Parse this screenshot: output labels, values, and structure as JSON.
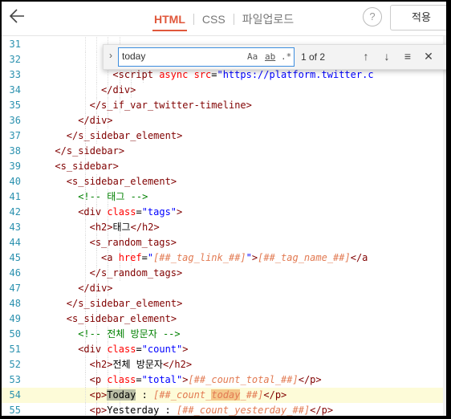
{
  "toolbar": {
    "back_icon": "arrow-left-icon",
    "tabs": [
      "HTML",
      "CSS",
      "파일업로드"
    ],
    "help_label": "?",
    "apply_label": "적용"
  },
  "find": {
    "value": "today",
    "opt_case": "Aa",
    "opt_word": "ab",
    "opt_regex": ".*",
    "match_count": "1 of 2"
  },
  "lines": [
    {
      "n": "31",
      "indent": 8,
      "html": ""
    },
    {
      "n": "32",
      "indent": 8,
      "html": ""
    },
    {
      "n": "33",
      "indent": 10,
      "html": "<span class='tag'>&lt;script</span> <span class='attr'>async</span> <span class='attr'>src</span>=<span class='str'>\"https://platform.twitter.c</span>"
    },
    {
      "n": "34",
      "indent": 9,
      "html": "<span class='tag'>&lt;/div&gt;</span>"
    },
    {
      "n": "35",
      "indent": 8,
      "html": "<span class='tag'>&lt;/s_if_var_twitter-timeline&gt;</span>"
    },
    {
      "n": "36",
      "indent": 7,
      "html": "<span class='tag'>&lt;/div&gt;</span>"
    },
    {
      "n": "37",
      "indent": 6,
      "html": "<span class='tag'>&lt;/s_sidebar_element&gt;</span>"
    },
    {
      "n": "38",
      "indent": 5,
      "html": "<span class='tag'>&lt;/s_sidebar&gt;</span>"
    },
    {
      "n": "39",
      "indent": 5,
      "html": "<span class='tag'>&lt;s_sidebar&gt;</span>"
    },
    {
      "n": "40",
      "indent": 6,
      "html": "<span class='tag'>&lt;s_sidebar_element&gt;</span>"
    },
    {
      "n": "41",
      "indent": 7,
      "html": "<span class='cmt'>&lt;!-- 태그 --&gt;</span>"
    },
    {
      "n": "42",
      "indent": 7,
      "html": "<span class='tag'>&lt;div</span> <span class='attr'>class</span>=<span class='str'>\"tags\"</span><span class='tag'>&gt;</span>"
    },
    {
      "n": "43",
      "indent": 8,
      "html": "<span class='tag'>&lt;h2&gt;</span>태그<span class='tag'>&lt;/h2&gt;</span>"
    },
    {
      "n": "44",
      "indent": 8,
      "html": "<span class='tag'>&lt;s_random_tags&gt;</span>"
    },
    {
      "n": "45",
      "indent": 9,
      "html": "<span class='tag'>&lt;a</span> <span class='attr'>href</span>=<span class='str'>\"</span><span class='tpl'>[##_tag_link_##]</span><span class='str'>\"</span><span class='tag'>&gt;</span><span class='tpl'>[##_tag_name_##]</span><span class='tag'>&lt;/a</span>"
    },
    {
      "n": "46",
      "indent": 8,
      "html": "<span class='tag'>&lt;/s_random_tags&gt;</span>"
    },
    {
      "n": "47",
      "indent": 7,
      "html": "<span class='tag'>&lt;/div&gt;</span>"
    },
    {
      "n": "48",
      "indent": 6,
      "html": "<span class='tag'>&lt;/s_sidebar_element&gt;</span>"
    },
    {
      "n": "49",
      "indent": 6,
      "html": "<span class='tag'>&lt;s_sidebar_element&gt;</span>"
    },
    {
      "n": "50",
      "indent": 7,
      "html": "<span class='cmt'>&lt;!-- 전체 방문자 --&gt;</span>"
    },
    {
      "n": "51",
      "indent": 7,
      "html": "<span class='tag'>&lt;div</span> <span class='attr'>class</span>=<span class='str'>\"count\"</span><span class='tag'>&gt;</span>"
    },
    {
      "n": "52",
      "indent": 8,
      "html": "<span class='tag'>&lt;h2&gt;</span>전체 방문자<span class='tag'>&lt;/h2&gt;</span>"
    },
    {
      "n": "53",
      "indent": 8,
      "html": "<span class='tag'>&lt;p</span> <span class='attr'>class</span>=<span class='str'>\"total\"</span><span class='tag'>&gt;</span><span class='tpl'>[##_count_total_##]</span><span class='tag'>&lt;/p&gt;</span>"
    },
    {
      "n": "54",
      "indent": 8,
      "current": true,
      "html": "<span class='tag'>&lt;p&gt;</span><span class='hl'>Today</span> : <span class='tpl'>[##_count_<span class='hl2'>today</span>_##]</span><span class='tag'>&lt;/p&gt;</span>"
    },
    {
      "n": "55",
      "indent": 8,
      "html": "<span class='tag'>&lt;p&gt;</span>Yesterday : <span class='tpl'>[##_count_yesterday_##]</span><span class='tag'>&lt;/p&gt;</span>"
    }
  ]
}
